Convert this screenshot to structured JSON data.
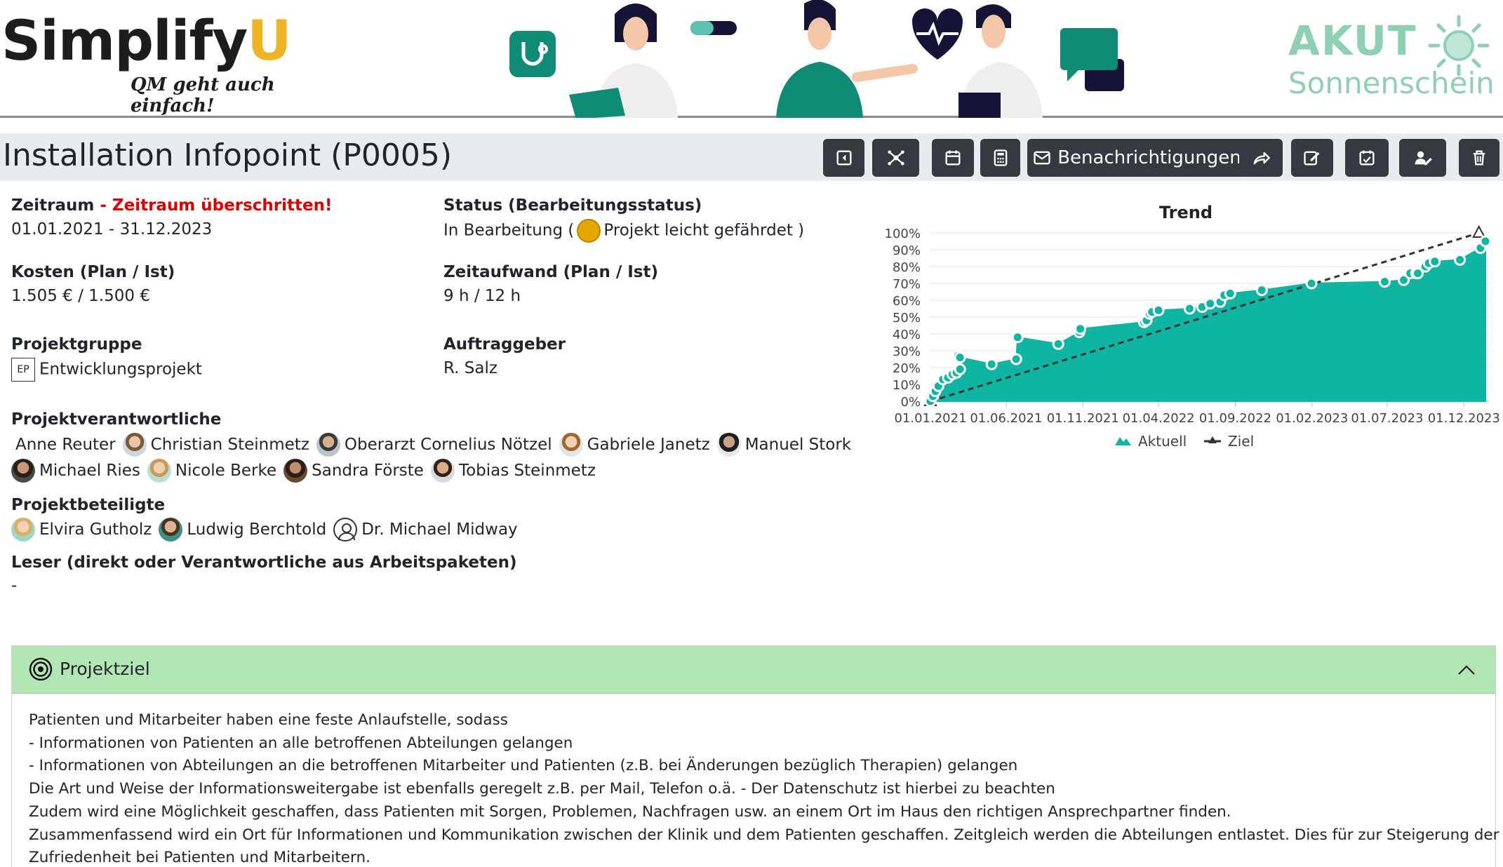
{
  "banner": {
    "logo_main": "Simplify",
    "logo_u": "U",
    "logo_tagline": "QM geht auch einfach!",
    "client_line1": "AKUT",
    "client_line2": "Sonnenschein"
  },
  "header": {
    "title": "Installation Infopoint (P0005)",
    "notifications_label": "Benachrichtigungen",
    "toolbar_icons": [
      "back-icon",
      "network-icon",
      "calendar-icon",
      "calculator-icon",
      "mail-icon",
      "share-icon",
      "edit-icon",
      "calendar-check-icon",
      "user-edit-icon",
      "trash-icon"
    ]
  },
  "info": {
    "zeitraum_label": "Zeitraum",
    "zeitraum_warning": " - Zeitraum überschritten!",
    "zeitraum_value": "01.01.2021 - 31.12.2023",
    "status_label": "Status (Bearbeitungsstatus)",
    "status_value": "In Bearbeitung (",
    "status_risk": "Projekt leicht gefährdet )",
    "status_color": "#e6a800",
    "kosten_label": "Kosten (Plan / Ist)",
    "kosten_value": "1.505 € / 1.500 €",
    "zeitaufwand_label": "Zeitaufwand (Plan / Ist)",
    "zeitaufwand_value": "9 h / 12 h",
    "gruppe_label": "Projektgruppe",
    "gruppe_badge": "EP",
    "gruppe_value": "Entwicklungsprojekt",
    "auftraggeber_label": "Auftraggeber",
    "auftraggeber_value": "R. Salz",
    "verantwortliche_label": "Projektverantwortliche",
    "verantwortliche_row1": [
      "Anne Reuter",
      "Christian Steinmetz",
      "Oberarzt Cornelius Nötzel",
      "Gabriele Janetz",
      "Manuel Stork"
    ],
    "verantwortliche_row2": [
      "Michael Ries",
      "Nicole Berke",
      "Sandra Förste",
      "Tobias Steinmetz"
    ],
    "beteiligte_label": "Projektbeteiligte",
    "beteiligte": [
      "Elvira Gutholz",
      "Ludwig Berchtold",
      "Dr. Michael Midway"
    ],
    "leser_label": "Leser (direkt oder Verantwortliche aus Arbeitspaketen)",
    "leser_value": "-"
  },
  "chart_data": {
    "type": "area",
    "title": "Trend",
    "xlabel": "",
    "ylabel": "",
    "x_ticks": [
      "01.01.2021",
      "01.06.2021",
      "01.11.2021",
      "01.04.2022",
      "01.09.2022",
      "01.02.2023",
      "01.07.2023",
      "01.12.2023"
    ],
    "y_ticks": [
      "0%",
      "10%",
      "20%",
      "30%",
      "40%",
      "50%",
      "60%",
      "70%",
      "80%",
      "90%",
      "100%"
    ],
    "ylim": [
      0,
      100
    ],
    "xlim": [
      "2021-01-01",
      "2024-01-20"
    ],
    "grid": true,
    "legend_position": "bottom",
    "series": [
      {
        "name": "Aktuell",
        "kind": "area",
        "color": "#0fb5a3",
        "points": [
          [
            "2021-01-01",
            0
          ],
          [
            "2021-01-06",
            3
          ],
          [
            "2021-01-11",
            6
          ],
          [
            "2021-01-17",
            9
          ],
          [
            "2021-01-26",
            13
          ],
          [
            "2021-02-05",
            14
          ],
          [
            "2021-02-14",
            16
          ],
          [
            "2021-02-22",
            17
          ],
          [
            "2021-03-01",
            19
          ],
          [
            "2021-02-25",
            27
          ],
          [
            "2021-03-01",
            26
          ],
          [
            "2021-05-03",
            22
          ],
          [
            "2021-06-21",
            25
          ],
          [
            "2021-06-24",
            38
          ],
          [
            "2021-09-13",
            34
          ],
          [
            "2021-10-25",
            41
          ],
          [
            "2021-10-27",
            43
          ],
          [
            "2022-03-03",
            47
          ],
          [
            "2022-03-08",
            48
          ],
          [
            "2022-03-14",
            52
          ],
          [
            "2022-03-19",
            53
          ],
          [
            "2022-04-01",
            54
          ],
          [
            "2022-06-02",
            55
          ],
          [
            "2022-06-27",
            56
          ],
          [
            "2022-07-13",
            58
          ],
          [
            "2022-08-02",
            59
          ],
          [
            "2022-08-10",
            63
          ],
          [
            "2022-08-22",
            64
          ],
          [
            "2022-10-24",
            66
          ],
          [
            "2023-01-31",
            70
          ],
          [
            "2023-06-26",
            71
          ],
          [
            "2023-08-03",
            72
          ],
          [
            "2023-08-16",
            76
          ],
          [
            "2023-08-28",
            76
          ],
          [
            "2023-08-31",
            76
          ],
          [
            "2023-09-15",
            80
          ],
          [
            "2023-09-22",
            82
          ],
          [
            "2023-10-04",
            83
          ],
          [
            "2023-11-23",
            84
          ],
          [
            "2024-01-03",
            91
          ],
          [
            "2024-01-13",
            95
          ]
        ]
      },
      {
        "name": "Ziel",
        "kind": "line",
        "style": "dashed",
        "color": "#333333",
        "points": [
          [
            "2021-01-01",
            0
          ],
          [
            "2023-12-31",
            100
          ]
        ]
      }
    ]
  },
  "goal": {
    "title": "Projektziel",
    "lines": [
      "Patienten und Mitarbeiter haben eine feste Anlaufstelle, sodass",
      "- Informationen von Patienten an alle betroffenen Abteilungen gelangen",
      "- Informationen von Abteilungen an die betroffenen Mitarbeiter und Patienten (z.B. bei Änderungen bezüglich Therapien) gelangen",
      "Die Art und Weise der Informationsweitergabe ist ebenfalls geregelt z.B. per Mail, Telefon o.ä. - Der Datenschutz ist hierbei zu beachten",
      "Zudem wird eine Möglichkeit geschaffen, dass Patienten mit Sorgen, Problemen, Nachfragen usw. an einem Ort im Haus den richtigen Ansprechpartner finden.",
      "Zusammenfassend wird ein Ort für Informationen und Kommunikation zwischen der Klinik und dem Patienten geschaffen. Zeitgleich werden die Abteilungen entlastet. Dies für zur Steigerung der",
      "Zufriedenheit bei Patienten und Mitarbeitern."
    ]
  }
}
